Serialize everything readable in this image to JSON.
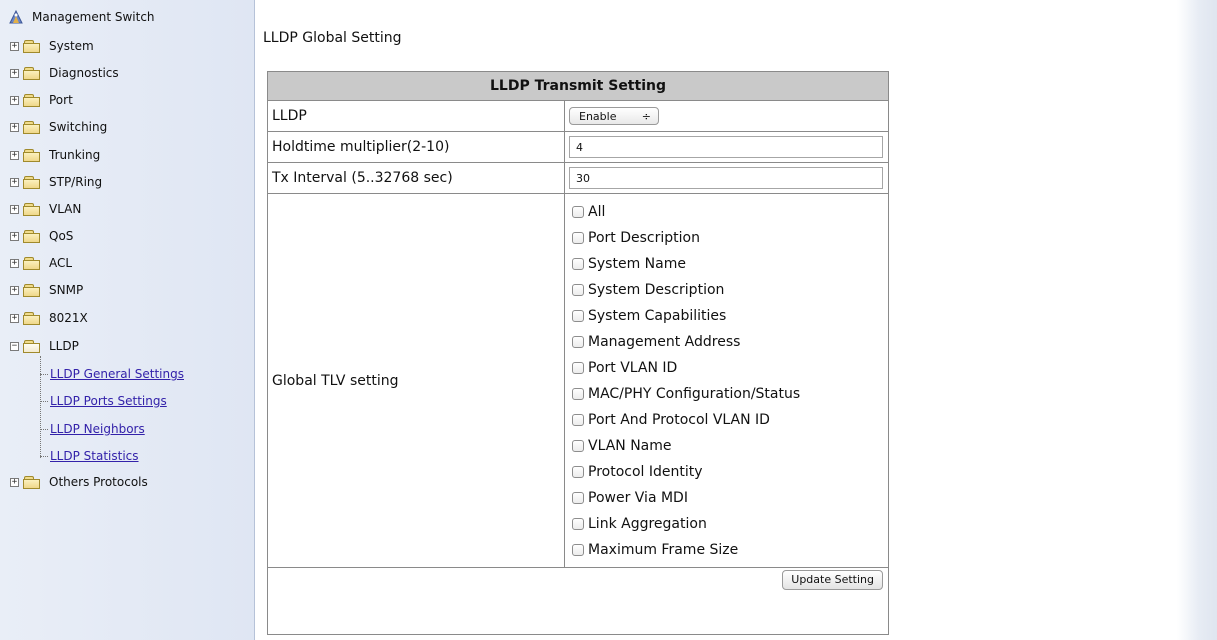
{
  "sidebar": {
    "root_label": "Management Switch",
    "items": [
      {
        "label": "System",
        "expander": "+",
        "open": false
      },
      {
        "label": "Diagnostics",
        "expander": "+",
        "open": false
      },
      {
        "label": "Port",
        "expander": "+",
        "open": false
      },
      {
        "label": "Switching",
        "expander": "+",
        "open": false
      },
      {
        "label": "Trunking",
        "expander": "+",
        "open": false
      },
      {
        "label": "STP/Ring",
        "expander": "+",
        "open": false
      },
      {
        "label": "VLAN",
        "expander": "+",
        "open": false
      },
      {
        "label": "QoS",
        "expander": "+",
        "open": false
      },
      {
        "label": "ACL",
        "expander": "+",
        "open": false
      },
      {
        "label": "SNMP",
        "expander": "+",
        "open": false
      },
      {
        "label": "8021X",
        "expander": "+",
        "open": false
      },
      {
        "label": "LLDP",
        "expander": "−",
        "open": true
      },
      {
        "label": "Others Protocols",
        "expander": "+",
        "open": false
      }
    ],
    "lldp_children": [
      {
        "label": "LLDP General Settings"
      },
      {
        "label": "LLDP Ports Settings"
      },
      {
        "label": "LLDP Neighbors"
      },
      {
        "label": "LLDP Statistics"
      }
    ]
  },
  "main": {
    "page_title": "LLDP Global Setting",
    "table_header": "LLDP Transmit Setting",
    "rows": {
      "lldp": {
        "label": "LLDP",
        "select_value": "Enable",
        "select_arrow": "÷"
      },
      "holdtime": {
        "label": "Holdtime multiplier(2-10)",
        "value": "4"
      },
      "tx_interval": {
        "label": "Tx Interval (5..32768 sec)",
        "value": "30"
      },
      "global_tlv": {
        "label": "Global TLV setting"
      }
    },
    "tlv_options": [
      {
        "label": "All",
        "checked": false
      },
      {
        "label": "Port Description",
        "checked": false
      },
      {
        "label": "System Name",
        "checked": false
      },
      {
        "label": "System Description",
        "checked": false
      },
      {
        "label": "System Capabilities",
        "checked": false
      },
      {
        "label": "Management Address",
        "checked": false
      },
      {
        "label": "Port VLAN ID",
        "checked": false
      },
      {
        "label": "MAC/PHY Configuration/Status",
        "checked": false
      },
      {
        "label": "Port And Protocol VLAN ID",
        "checked": false
      },
      {
        "label": "VLAN Name",
        "checked": false
      },
      {
        "label": "Protocol Identity",
        "checked": false
      },
      {
        "label": "Power Via MDI",
        "checked": false
      },
      {
        "label": "Link Aggregation",
        "checked": false
      },
      {
        "label": "Maximum Frame Size",
        "checked": false
      }
    ],
    "update_button": "Update Setting"
  },
  "colors": {
    "header_bg": "#c9c9c9",
    "link": "#3322aa",
    "sidebar_bg": "#e9eef7"
  }
}
